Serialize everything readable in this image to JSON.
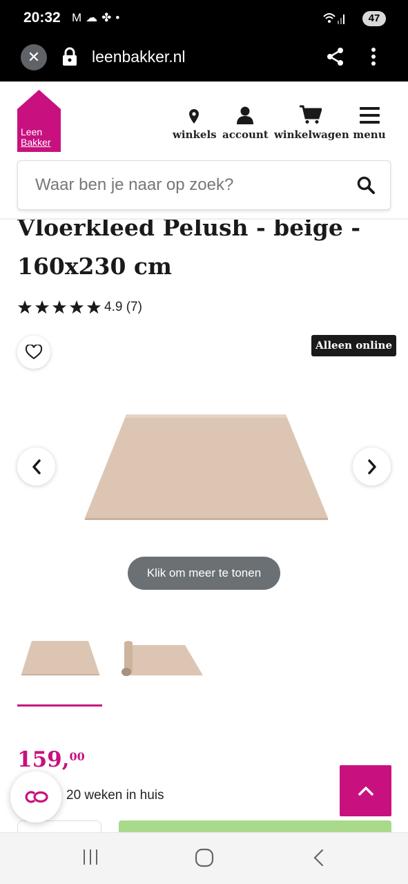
{
  "status_bar": {
    "time": "20:32",
    "notif_icons": [
      "gmail-icon",
      "cloud-icon",
      "fan-icon",
      "dot-icon"
    ],
    "battery": "47"
  },
  "browser": {
    "url": "leenbakker.nl"
  },
  "header": {
    "logo_line1": "Leen",
    "logo_line2": "Bakker",
    "nav": [
      {
        "label": "winkels",
        "icon": "location-pin-icon"
      },
      {
        "label": "account",
        "icon": "user-icon"
      },
      {
        "label": "winkelwagen",
        "icon": "cart-icon"
      },
      {
        "label": "menu",
        "icon": "hamburger-icon"
      }
    ],
    "search_placeholder": "Waar ben je naar op zoek?"
  },
  "product": {
    "title": "Vloerkleed Pelush - beige - 160x230 cm",
    "rating": 4.9,
    "rating_text": "4.9 (7)",
    "badge": "Alleen online",
    "show_more": "Klik om meer te tonen",
    "price_main": "159,",
    "price_cents": "00",
    "delivery": "20 weken in huis"
  },
  "colors": {
    "brand": "#c8117f",
    "rug": "#dcc6b3",
    "cta_green": "#a9d98a"
  }
}
